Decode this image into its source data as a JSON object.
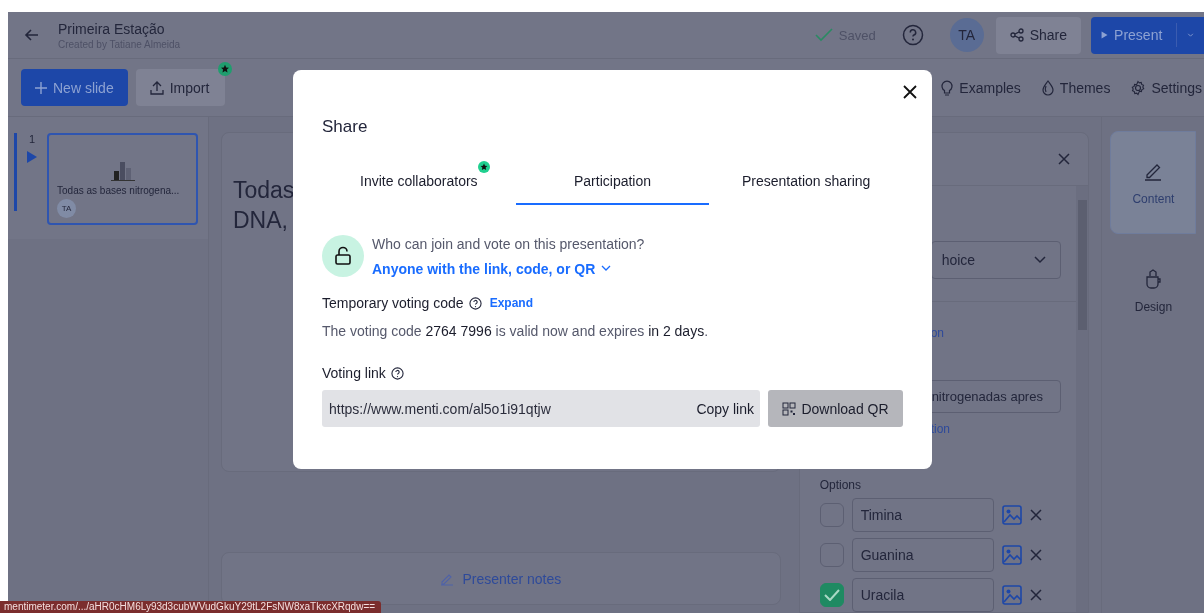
{
  "header": {
    "title": "Primeira Estação",
    "subtitle": "Created by Tatiane Almeida",
    "saved": "Saved",
    "avatar": "TA",
    "share": "Share",
    "present": "Present"
  },
  "toolbar": {
    "new_slide": "New slide",
    "import": "Import",
    "links": [
      {
        "label": "Examples"
      },
      {
        "label": "Themes"
      },
      {
        "label": "Settings"
      }
    ]
  },
  "slides": [
    {
      "number": "1",
      "title": "Todas as bases nitrogena...",
      "author": "TA",
      "selected": true
    }
  ],
  "canvas": {
    "title_lines": [
      "Todas",
      "DNA,"
    ],
    "presenter_notes": "Presenter notes"
  },
  "editor": {
    "type_value": "hoice",
    "link_1": "on",
    "question_value": "nitrogenadas apres",
    "link_2": "tion",
    "options_label": "Options",
    "options": [
      {
        "text": "Timina",
        "checked": false
      },
      {
        "text": "Guanina",
        "checked": false
      },
      {
        "text": "Uracila",
        "checked": true
      }
    ]
  },
  "rail": [
    {
      "label": "Content",
      "selected": true
    },
    {
      "label": "Design",
      "selected": false
    }
  ],
  "status_url": "mentimeter.com/.../aHR0cHM6Ly93d3cubWVudGkuY29tL2FsNW8xaTkxcXRqdw==",
  "modal": {
    "title": "Share",
    "tabs": [
      {
        "label": "Invite collaborators",
        "badge": true,
        "selected": false
      },
      {
        "label": "Participation",
        "badge": false,
        "selected": true
      },
      {
        "label": "Presentation sharing",
        "badge": false,
        "selected": false
      }
    ],
    "access_question": "Who can join and vote on this presentation?",
    "access_value": "Anyone with the link, code, or QR",
    "code_label": "Temporary voting code",
    "expand": "Expand",
    "code_text": "The voting code **2764 7996** is valid now and expires **in 2 days**.",
    "link_label": "Voting link",
    "link_value": "https://www.menti.com/al5o1i91qtjw",
    "copy": "Copy link",
    "download": "Download QR"
  }
}
